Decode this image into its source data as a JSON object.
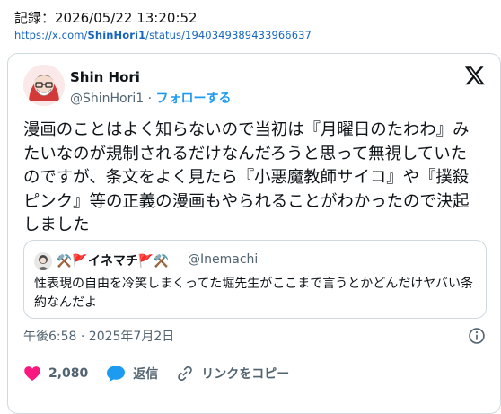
{
  "record": "記録：2026/05/22 13:20:52",
  "link": {
    "prefix": "https://x.com/",
    "bold": "ShinHori1",
    "suffix": "/status/1940349389433966637"
  },
  "tweet": {
    "name": "Shin Hori",
    "handle": "@ShinHori1",
    "separator": "·",
    "follow": "フォローする",
    "text": "漫画のことはよく知らないので当初は『月曜日のたわわ』みたいなのが規制されるだけなんだろうと思って無視していたのですが、条文をよく見たら『小悪魔教師サイコ』や『撲殺ピンク』等の正義の漫画もやられることがわかったので決起しました",
    "timestamp": "午後6:58 · 2025年7月2日",
    "likes": "2,080",
    "reply": "返信",
    "copy_link": "リンクをコピー"
  },
  "quote": {
    "name": "⚒️🚩イネマチ🚩⚒️",
    "handle": "@Inemachi",
    "text": "性表現の自由を冷笑しまくってた堀先生がここまで言うとかどんだけヤバい条約なんだよ"
  },
  "icons": {
    "x_logo": "x-logo",
    "info": "info-icon",
    "heart": "heart-icon",
    "reply": "reply-icon",
    "link": "link-icon"
  },
  "colors": {
    "follow": "#1d9bf0",
    "heart": "#f91880",
    "reply": "#1d9bf0",
    "muted": "#536471"
  }
}
